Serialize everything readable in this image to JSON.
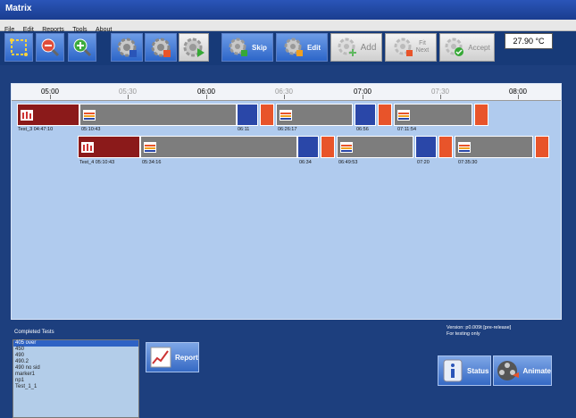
{
  "window_title": "Matrix",
  "menu": [
    "File",
    "Edit",
    "Reports",
    "Tools",
    "About"
  ],
  "toolbar": {
    "skip_label": "Skip",
    "edit_label": "Edit",
    "add_label": "Add",
    "fit_next_label_1": "Fit",
    "fit_next_label_2": "Next",
    "accept_label": "Accept"
  },
  "temperature": "27.90 °C",
  "timeline": {
    "ticks": [
      "05:00",
      "05:30",
      "06:00",
      "06:30",
      "07:00",
      "07:30",
      "08:00"
    ],
    "row1": {
      "name_time": "Test_3  04:47:10",
      "labels": [
        "05:10:43",
        "06:11",
        "06:26:17",
        "06:56",
        "07:11:54"
      ]
    },
    "row2": {
      "name_time": "Test_4  05:10:43",
      "labels": [
        "05:34:16",
        "06:34",
        "06:49:53",
        "07:20",
        "07:35:30"
      ]
    }
  },
  "completed_tests_label": "Completed Tests",
  "completed_tests": [
    "405 over",
    "450",
    "490",
    "490.2",
    "490 no sid",
    "marker1",
    "np1",
    "Test_1_1"
  ],
  "selected_test_index": 0,
  "report_label": "Report",
  "version_line1": "Version: p0.009t [pre-release]",
  "version_line2": "For testing only",
  "status_label": "Status",
  "animate_label": "Animate",
  "colors": {
    "active": "#8b1a1a",
    "gap": "#7d7d7d",
    "blue": "#2a47a8",
    "orange": "#e8542a",
    "panel": "#b0cbee"
  }
}
